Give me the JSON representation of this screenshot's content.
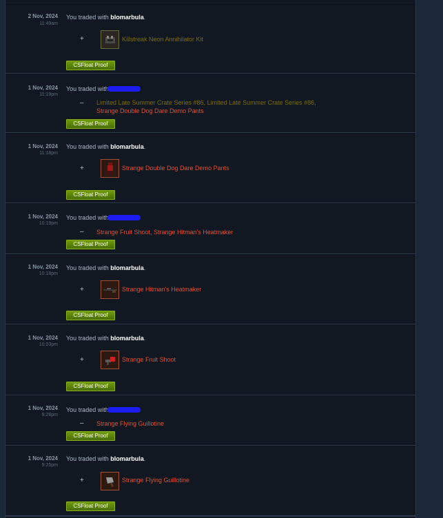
{
  "trades": [
    {
      "date": "2 Nov, 2024",
      "time": "11:49am",
      "prefix": "You traded with ",
      "partner": "blomarbula",
      "suffix": ".",
      "redacted": false,
      "sign": "+",
      "icon": "killstreak-kit-icon",
      "items_text": "Killstreak Neon Annihilator Kit",
      "item_color": "#7d6d00",
      "proof_label": "CSFloat Proof"
    },
    {
      "date": "1 Nov, 2024",
      "time": "11:19pm",
      "prefix": "You traded with",
      "partner": "",
      "suffix": "",
      "redacted": true,
      "sign": "–",
      "items_line1": "Limited Late Summer Crate Series #86, Limited Late Summer Crate Series #86,",
      "items_line2": "Strange Double Dog Dare Demo Pants",
      "proof_label": "CSFloat Proof"
    },
    {
      "date": "1 Nov, 2024",
      "time": "11:18pm",
      "prefix": "You traded with ",
      "partner": "blomarbula",
      "suffix": ".",
      "redacted": false,
      "sign": "+",
      "icon": "demo-pants-icon",
      "items_text": "Strange Double Dog Dare Demo Pants",
      "item_color": "#cf6a32",
      "proof_label": "CSFloat Proof"
    },
    {
      "date": "1 Nov, 2024",
      "time": "10:19pm",
      "prefix": "You traded with",
      "partner": "",
      "suffix": "",
      "redacted": true,
      "sign": "–",
      "items_text": "Strange Fruit Shoot, Strange Hitman's Heatmaker",
      "proof_label": "CSFloat Proof"
    },
    {
      "date": "1 Nov, 2024",
      "time": "10:18pm",
      "prefix": "You traded with ",
      "partner": "blomarbula",
      "suffix": ".",
      "redacted": false,
      "sign": "+",
      "icon": "sniper-rifle-icon",
      "items_text": "Strange Hitman's Heatmaker",
      "item_color": "#cf6a32",
      "proof_label": "CSFloat Proof"
    },
    {
      "date": "1 Nov, 2024",
      "time": "10:03pm",
      "prefix": "You traded with ",
      "partner": "blomarbula",
      "suffix": ".",
      "redacted": false,
      "sign": "+",
      "icon": "fruit-shoot-icon",
      "items_text": "Strange Fruit Shoot",
      "item_color": "#cf6a32",
      "proof_label": "CSFloat Proof"
    },
    {
      "date": "1 Nov, 2024",
      "time": "9:26pm",
      "prefix": "You traded with",
      "partner": "",
      "suffix": "",
      "redacted": true,
      "sign": "–",
      "items_text": "Strange Flying Guillotine",
      "proof_label": "CSFloat Proof"
    },
    {
      "date": "1 Nov, 2024",
      "time": "9:25pm",
      "prefix": "You traded with ",
      "partner": "blomarbula",
      "suffix": ".",
      "redacted": false,
      "sign": "+",
      "icon": "cleaver-icon",
      "items_text": "Strange Flying Guillotine",
      "item_color": "#cf6a32",
      "proof_label": "CSFloat Proof"
    }
  ]
}
